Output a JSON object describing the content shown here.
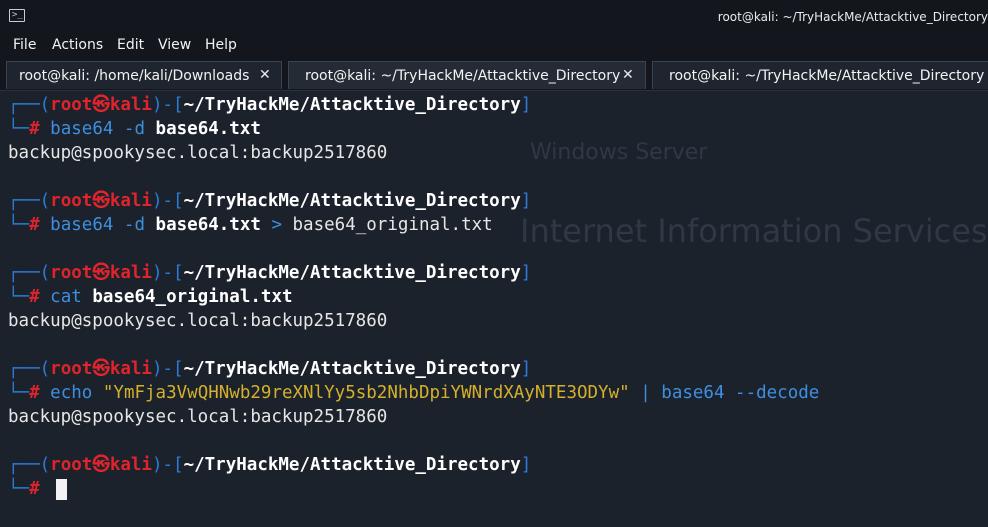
{
  "window": {
    "title": "root@kali: ~/TryHackMe/Attacktive_Directory",
    "icon": "terminal-icon"
  },
  "menu": [
    "File",
    "Actions",
    "Edit",
    "View",
    "Help"
  ],
  "tabs": [
    {
      "label": "root@kali: /home/kali/Downloads",
      "close": "✕"
    },
    {
      "label": "root@kali: ~/TryHackMe/Attacktive_Directory",
      "close": "✕"
    },
    {
      "label": "root@kali: ~/TryHackMe/Attacktive_Directory",
      "close": ""
    }
  ],
  "prompt": {
    "open": "┌──(",
    "user": "root",
    "skull": "㉿",
    "host": "kali",
    "mid": ")-[",
    "path": "~/TryHackMe/Attacktive_Directory",
    "close": "]",
    "second": "└─",
    "hash": "#"
  },
  "blocks": [
    {
      "cmd": "base64",
      "args": " -d ",
      "file": "base64.txt",
      "redirect": "",
      "out_file": "",
      "output": "backup@spookysec.local:backup2517860"
    },
    {
      "cmd": "base64",
      "args": " -d ",
      "file": "base64.txt",
      "redirect": " > ",
      "out_file": "base64_original.txt",
      "output": ""
    },
    {
      "cmd": "cat",
      "args": " ",
      "file": "base64_original.txt",
      "redirect": "",
      "out_file": "",
      "output": "backup@spookysec.local:backup2517860"
    },
    {
      "cmd": "echo",
      "args": " ",
      "string": "\"YmFja3VwQHNwb29reXNlYy5sb2NhbDpiYWNrdXAyNTE3ODYw\"",
      "pipe": " | ",
      "cmd2": "base64",
      "args2": " --decode",
      "output": "backup@spookysec.local:backup2517860"
    }
  ],
  "colors": {
    "accent": "#2b7cd8",
    "user": "#e0242b",
    "string": "#d4b02c",
    "bg": "#1c222b"
  }
}
